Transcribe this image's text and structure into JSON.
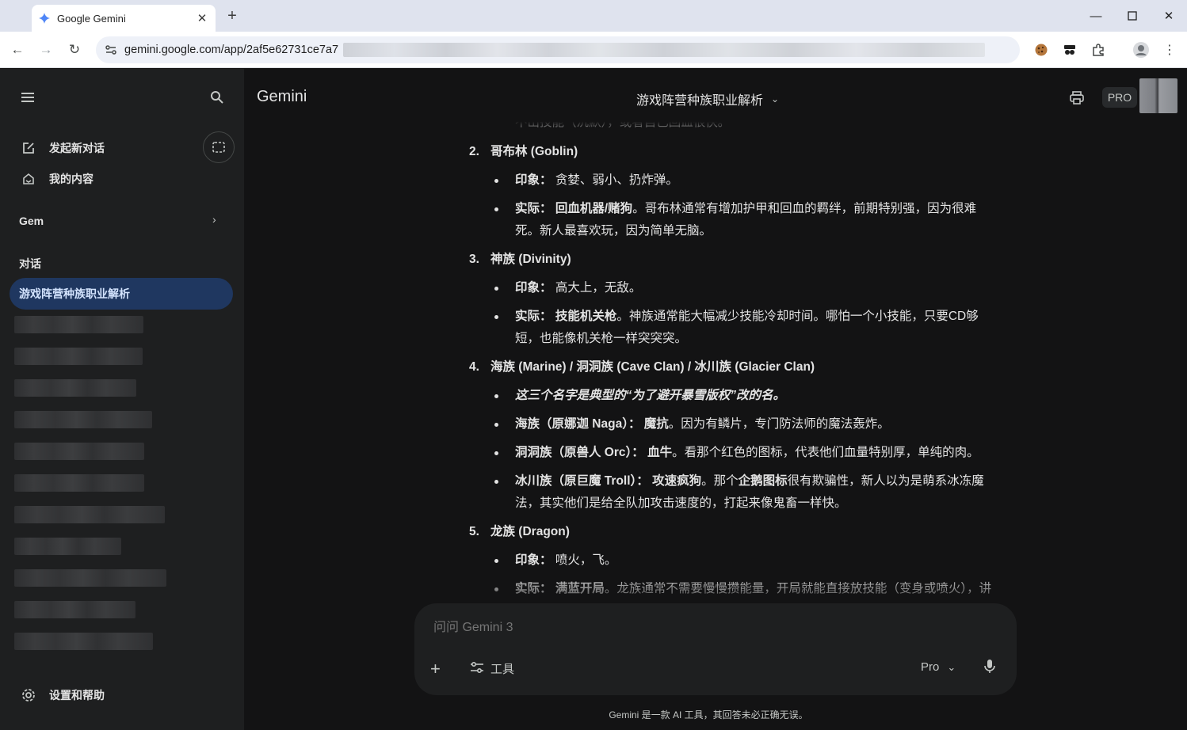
{
  "browser": {
    "tab_title": "Google Gemini",
    "new_tab_label": "+",
    "url_visible": "gemini.google.com/app/2af5e62731ce7a7"
  },
  "sidebar": {
    "new_chat": "发起新对话",
    "my_content": "我的内容",
    "gem_section": "Gem",
    "chats_section": "对话",
    "active_chat": "游戏阵营种族职业解析",
    "settings": "设置和帮助"
  },
  "topbar": {
    "app_name": "Gemini",
    "conversation_title": "游戏阵营种族职业解析",
    "pro_badge": "PRO"
  },
  "content": {
    "cut_line": "不出技能（沉默），或者自己回血很快。",
    "items": [
      {
        "num": "2.",
        "heading": "哥布林 (Goblin)"
      },
      {
        "num": "3.",
        "heading": "神族 (Divinity)"
      },
      {
        "num": "4.",
        "heading": "海族 (Marine) / 洞洞族 (Cave Clan) / 冰川族 (Glacier Clan)"
      },
      {
        "num": "5.",
        "heading": "龙族 (Dragon)"
      }
    ],
    "goblin_impression_label": "印象：",
    "goblin_impression": "贪婪、弱小、扔炸弹。",
    "goblin_actual_label": "实际：",
    "goblin_actual_bold": "回血机器/赌狗",
    "goblin_actual_1": "。哥布林通常有增加护甲和回血的羁绊，前期特别强，因为很难",
    "goblin_actual_2": "死。新人最喜欢玩，因为简单无脑。",
    "divinity_impression_label": "印象：",
    "divinity_impression": "高大上，无敌。",
    "divinity_actual_label": "实际：",
    "divinity_actual_bold": "技能机关枪",
    "divinity_actual_1": "。神族通常能大幅减少技能冷却时间。哪怕一个小技能，只要CD够",
    "divinity_actual_2": "短，也能像机关枪一样突突突。",
    "clans_note": "这三个名字是典型的“为了避开暴雪版权”改的名。",
    "marine_label": "海族（原娜迦 Naga）：",
    "marine_bold": "魔抗",
    "marine_text": "。因为有鳞片，专门防法师的魔法轰炸。",
    "cave_label": "洞洞族（原兽人 Orc）：",
    "cave_bold": "血牛",
    "cave_text": "。看那个红色的图标，代表他们血量特别厚，单纯的肉。",
    "glacier_label": "冰川族（原巨魔 Troll）：",
    "glacier_bold": "攻速疯狗",
    "glacier_text_1": "。那个",
    "glacier_text_bold": "企鹅图标",
    "glacier_text_2": "很有欺骗性，新人以为是萌系冰冻魔",
    "glacier_text_3": "法，其实他们是给全队加攻击速度的，打起来像鬼畜一样快。",
    "dragon_impression_label": "印象：",
    "dragon_impression": "喷火，飞。",
    "dragon_actual_label": "实际：",
    "dragon_actual_bold": "满蓝开局",
    "dragon_actual_1": "。龙族通常不需要慢慢攒能量，开局就能直接放技能（变身或喷火），讲"
  },
  "input": {
    "placeholder": "问问 Gemini 3",
    "tools_label": "工具",
    "model_label": "Pro"
  },
  "disclaimer": "Gemini 是一款 AI 工具，其回答未必正确无误。"
}
